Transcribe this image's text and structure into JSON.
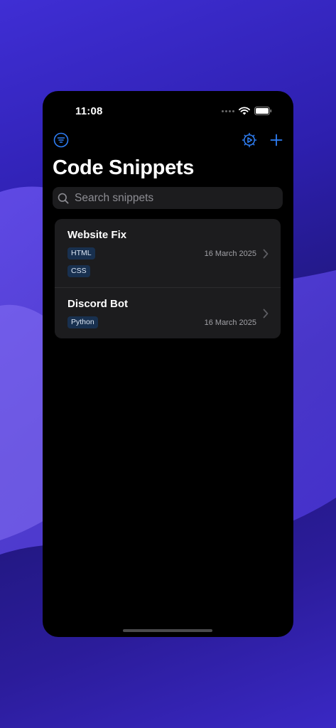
{
  "status_bar": {
    "time": "11:08"
  },
  "toolbar": {
    "left_icon": "filter-icon",
    "right_icons": [
      "settings-icon",
      "add-icon"
    ]
  },
  "page": {
    "title": "Code Snippets"
  },
  "search": {
    "placeholder": "Search snippets",
    "value": ""
  },
  "snippets": [
    {
      "title": "Website Fix",
      "tags": [
        "HTML",
        "CSS"
      ],
      "date": "16 March 2025"
    },
    {
      "title": "Discord Bot",
      "tags": [
        "Python"
      ],
      "date": "16 March 2025"
    }
  ],
  "colors": {
    "accent": "#2f7ff6",
    "background": "#000000",
    "card": "#1c1c1e",
    "tag_background": "#18304f"
  }
}
